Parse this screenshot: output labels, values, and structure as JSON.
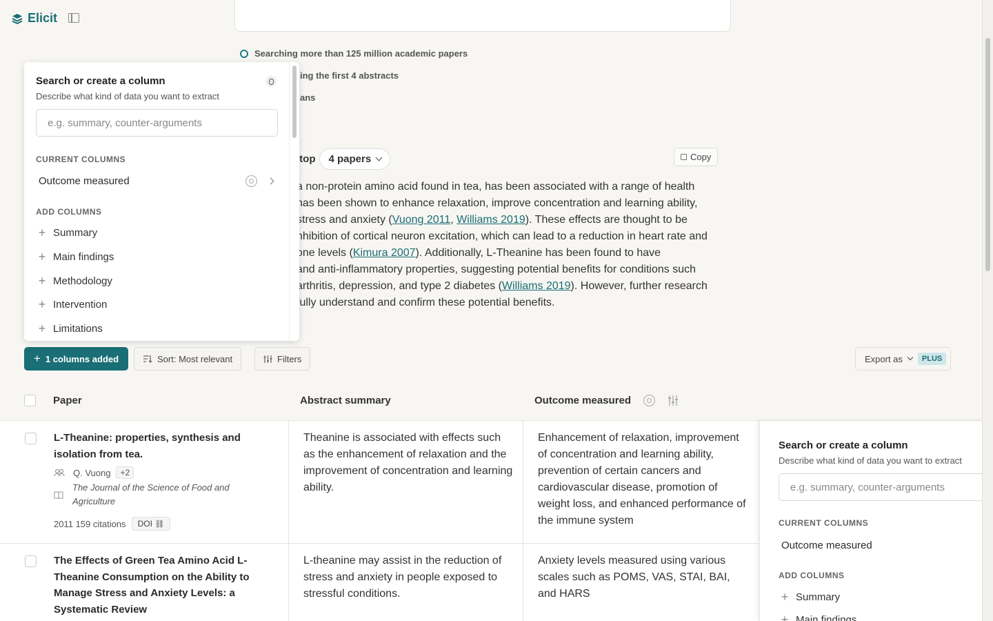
{
  "app": {
    "name": "Elicit"
  },
  "status": [
    "Searching more than 125 million academic papers",
    "ing the first 4 abstracts",
    "ans"
  ],
  "summary": {
    "prefix": "f top",
    "papers_label": "4 papers",
    "copy_label": "Copy",
    "lines": [
      [
        "a non-protein amino acid found in tea, has been associated with a range of health"
      ],
      [
        "has been shown to enhance relaxation, improve concentration and learning ability,"
      ],
      [
        "stress and anxiety (",
        "Vuong 2011",
        ", ",
        "Williams 2019",
        "). These effects are thought to be"
      ],
      [
        "nhibition of cortical neuron excitation, which can lead to a reduction in heart rate and"
      ],
      [
        "one levels (",
        "Kimura 2007",
        "). Additionally, L-Theanine has been found to have"
      ],
      [
        "and anti-inflammatory properties, suggesting potential benefits for conditions such"
      ],
      [
        "arthritis, depression, and type 2 diabetes (",
        "Williams 2019",
        "). However, further research"
      ],
      [
        " fully understand and confirm these potential benefits."
      ]
    ]
  },
  "column_panel": {
    "title": "Search or create a column",
    "description": "Describe what kind of data you want to extract",
    "input_placeholder": "e.g. summary, counter-arguments",
    "current_label": "CURRENT COLUMNS",
    "current_columns": [
      "Outcome measured"
    ],
    "add_label": "ADD COLUMNS",
    "add_columns": [
      "Summary",
      "Main findings",
      "Methodology",
      "Intervention",
      "Limitations"
    ]
  },
  "toolbar": {
    "add_columns_label": "1 columns added",
    "sort_label": "Sort: Most relevant",
    "filters_label": "Filters",
    "export_label": "Export as",
    "plus_badge": "PLUS"
  },
  "table": {
    "headers": {
      "paper": "Paper",
      "abstract": "Abstract summary",
      "outcome": "Outcome measured"
    },
    "rows": [
      {
        "title": "L-Theanine: properties, synthesis and isolation from tea.",
        "author": "Q. Vuong",
        "extra_authors": "+2",
        "journal": "The Journal of the Science of Food and Agriculture",
        "year_citations": "2011 159 citations",
        "doi": "DOI",
        "abstract": "Theanine is associated with effects such as the enhancement of relaxation and the improvement of concentration and learning ability.",
        "outcome": "Enhancement of relaxation, improvement of concentration and learning ability, prevention of certain cancers and cardiovascular disease, promotion of weight loss, and enhanced performance of the immune system"
      },
      {
        "title": "The Effects of Green Tea Amino Acid L-Theanine Consumption on the Ability to Manage Stress and Anxiety Levels: a Systematic Review",
        "abstract": "L-theanine may assist in the reduction of stress and anxiety in people exposed to stressful conditions.",
        "outcome": "Anxiety levels measured using various scales such as POMS, VAS, STAI, BAI, and HARS"
      }
    ]
  },
  "right_panel": {
    "title": "Search or create a column",
    "description": "Describe what kind of data you want to extract",
    "input_placeholder": "e.g. summary, counter-arguments",
    "current_label": "CURRENT COLUMNS",
    "current_columns": [
      "Outcome measured"
    ],
    "add_label": "ADD COLUMNS",
    "add_columns": [
      "Summary",
      "Main findings"
    ]
  },
  "colors": {
    "brand": "#1a6e75",
    "plus_badge_bg": "#cfe6ea"
  }
}
